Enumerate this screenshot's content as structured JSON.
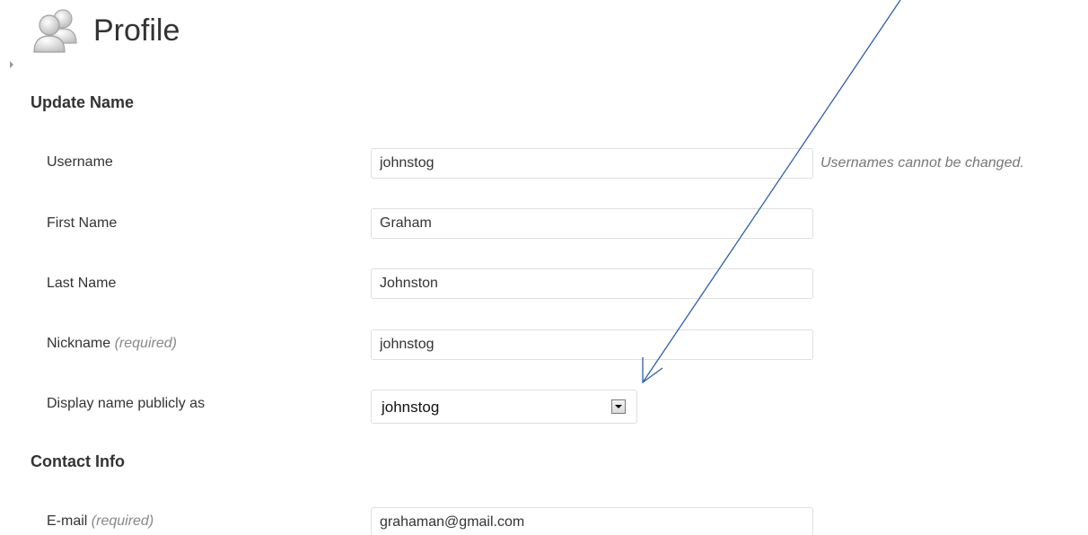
{
  "header": {
    "title": "Profile",
    "icon": "users-icon"
  },
  "sections": {
    "update_name": {
      "heading": "Update Name"
    },
    "contact_info": {
      "heading": "Contact Info"
    }
  },
  "fields": {
    "username": {
      "label": "Username",
      "value": "johnstog",
      "hint": "Usernames cannot be changed."
    },
    "first_name": {
      "label": "First Name",
      "value": "Graham"
    },
    "last_name": {
      "label": "Last Name",
      "value": "Johnston"
    },
    "nickname": {
      "label": "Nickname",
      "required": "(required)",
      "value": "johnstog"
    },
    "display_name": {
      "label": "Display name publicly as",
      "selected": "johnstog"
    },
    "email": {
      "label": "E-mail",
      "required": "(required)",
      "value": "grahaman@gmail.com"
    }
  },
  "colors": {
    "text": "#333333",
    "required_text": "#888888",
    "input_border": "#dfdfdf",
    "annotation_arrow": "#2e5fa8"
  }
}
